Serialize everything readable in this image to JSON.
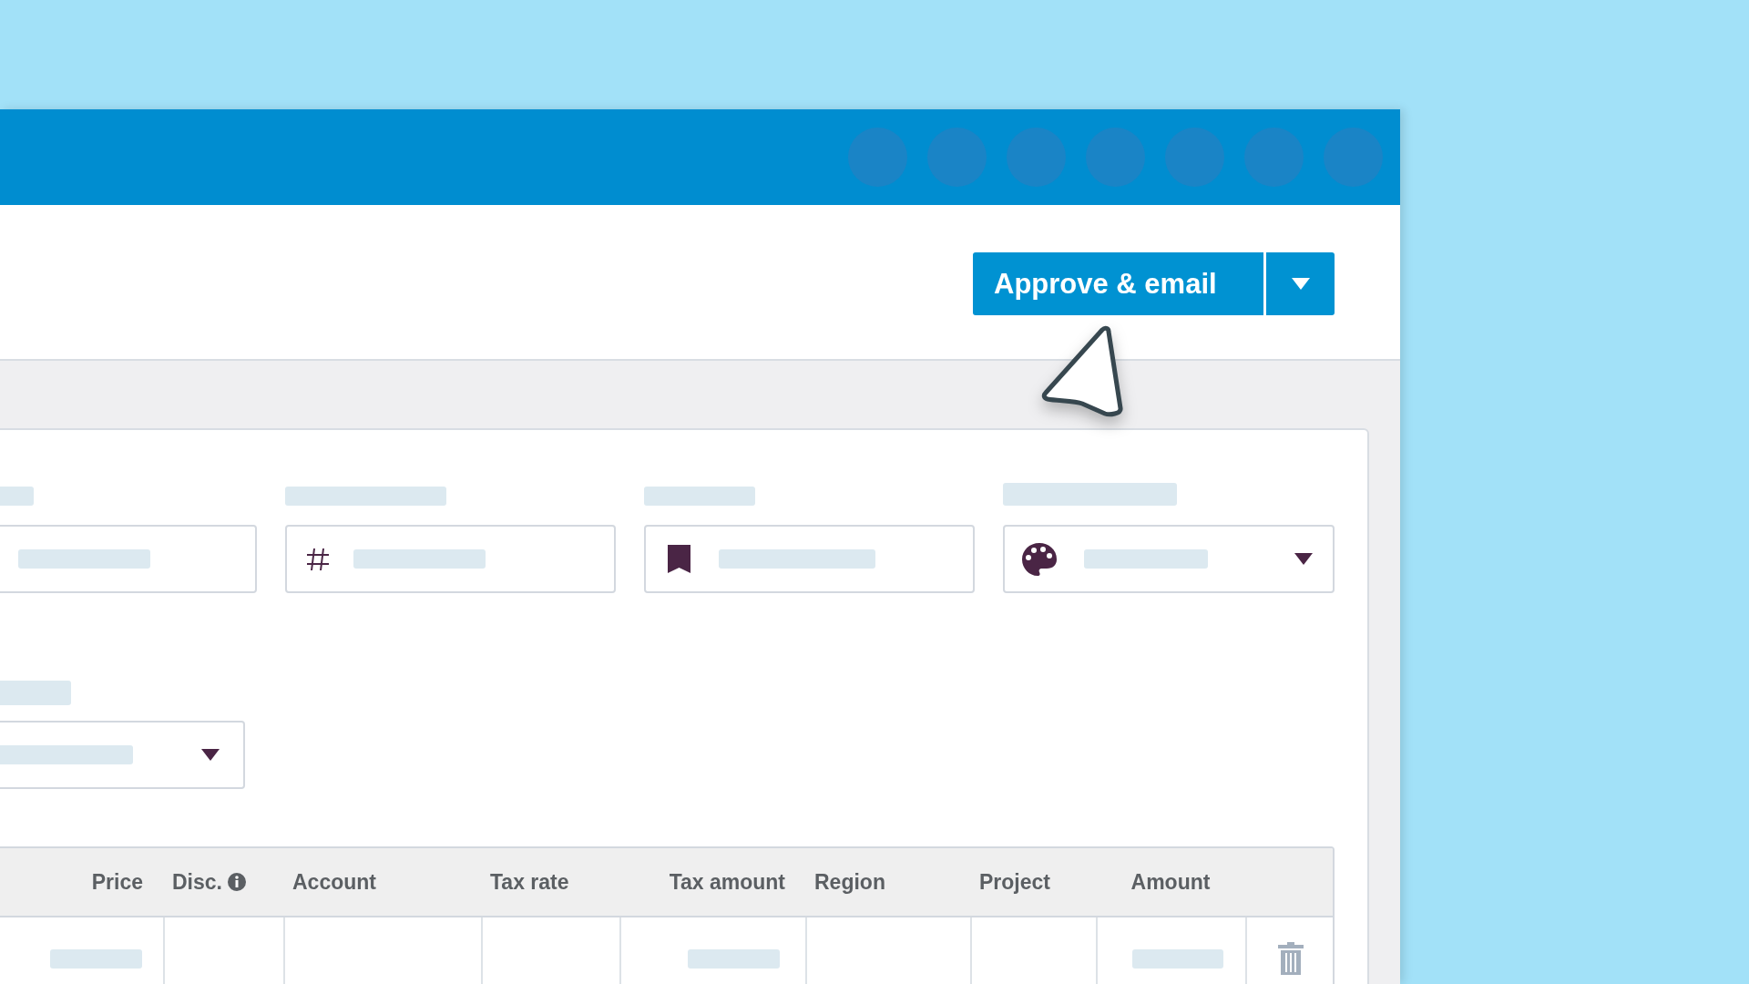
{
  "toolbar": {
    "primary_button": {
      "label": "Approve & email"
    }
  },
  "table": {
    "columns": [
      {
        "label": "Price",
        "info": false
      },
      {
        "label": "Disc.",
        "info": true
      },
      {
        "label": "Account",
        "info": false
      },
      {
        "label": "Tax rate",
        "info": false
      },
      {
        "label": "Tax amount",
        "info": false
      },
      {
        "label": "Region",
        "info": false
      },
      {
        "label": "Project",
        "info": false
      },
      {
        "label": "Amount",
        "info": false
      }
    ]
  }
}
